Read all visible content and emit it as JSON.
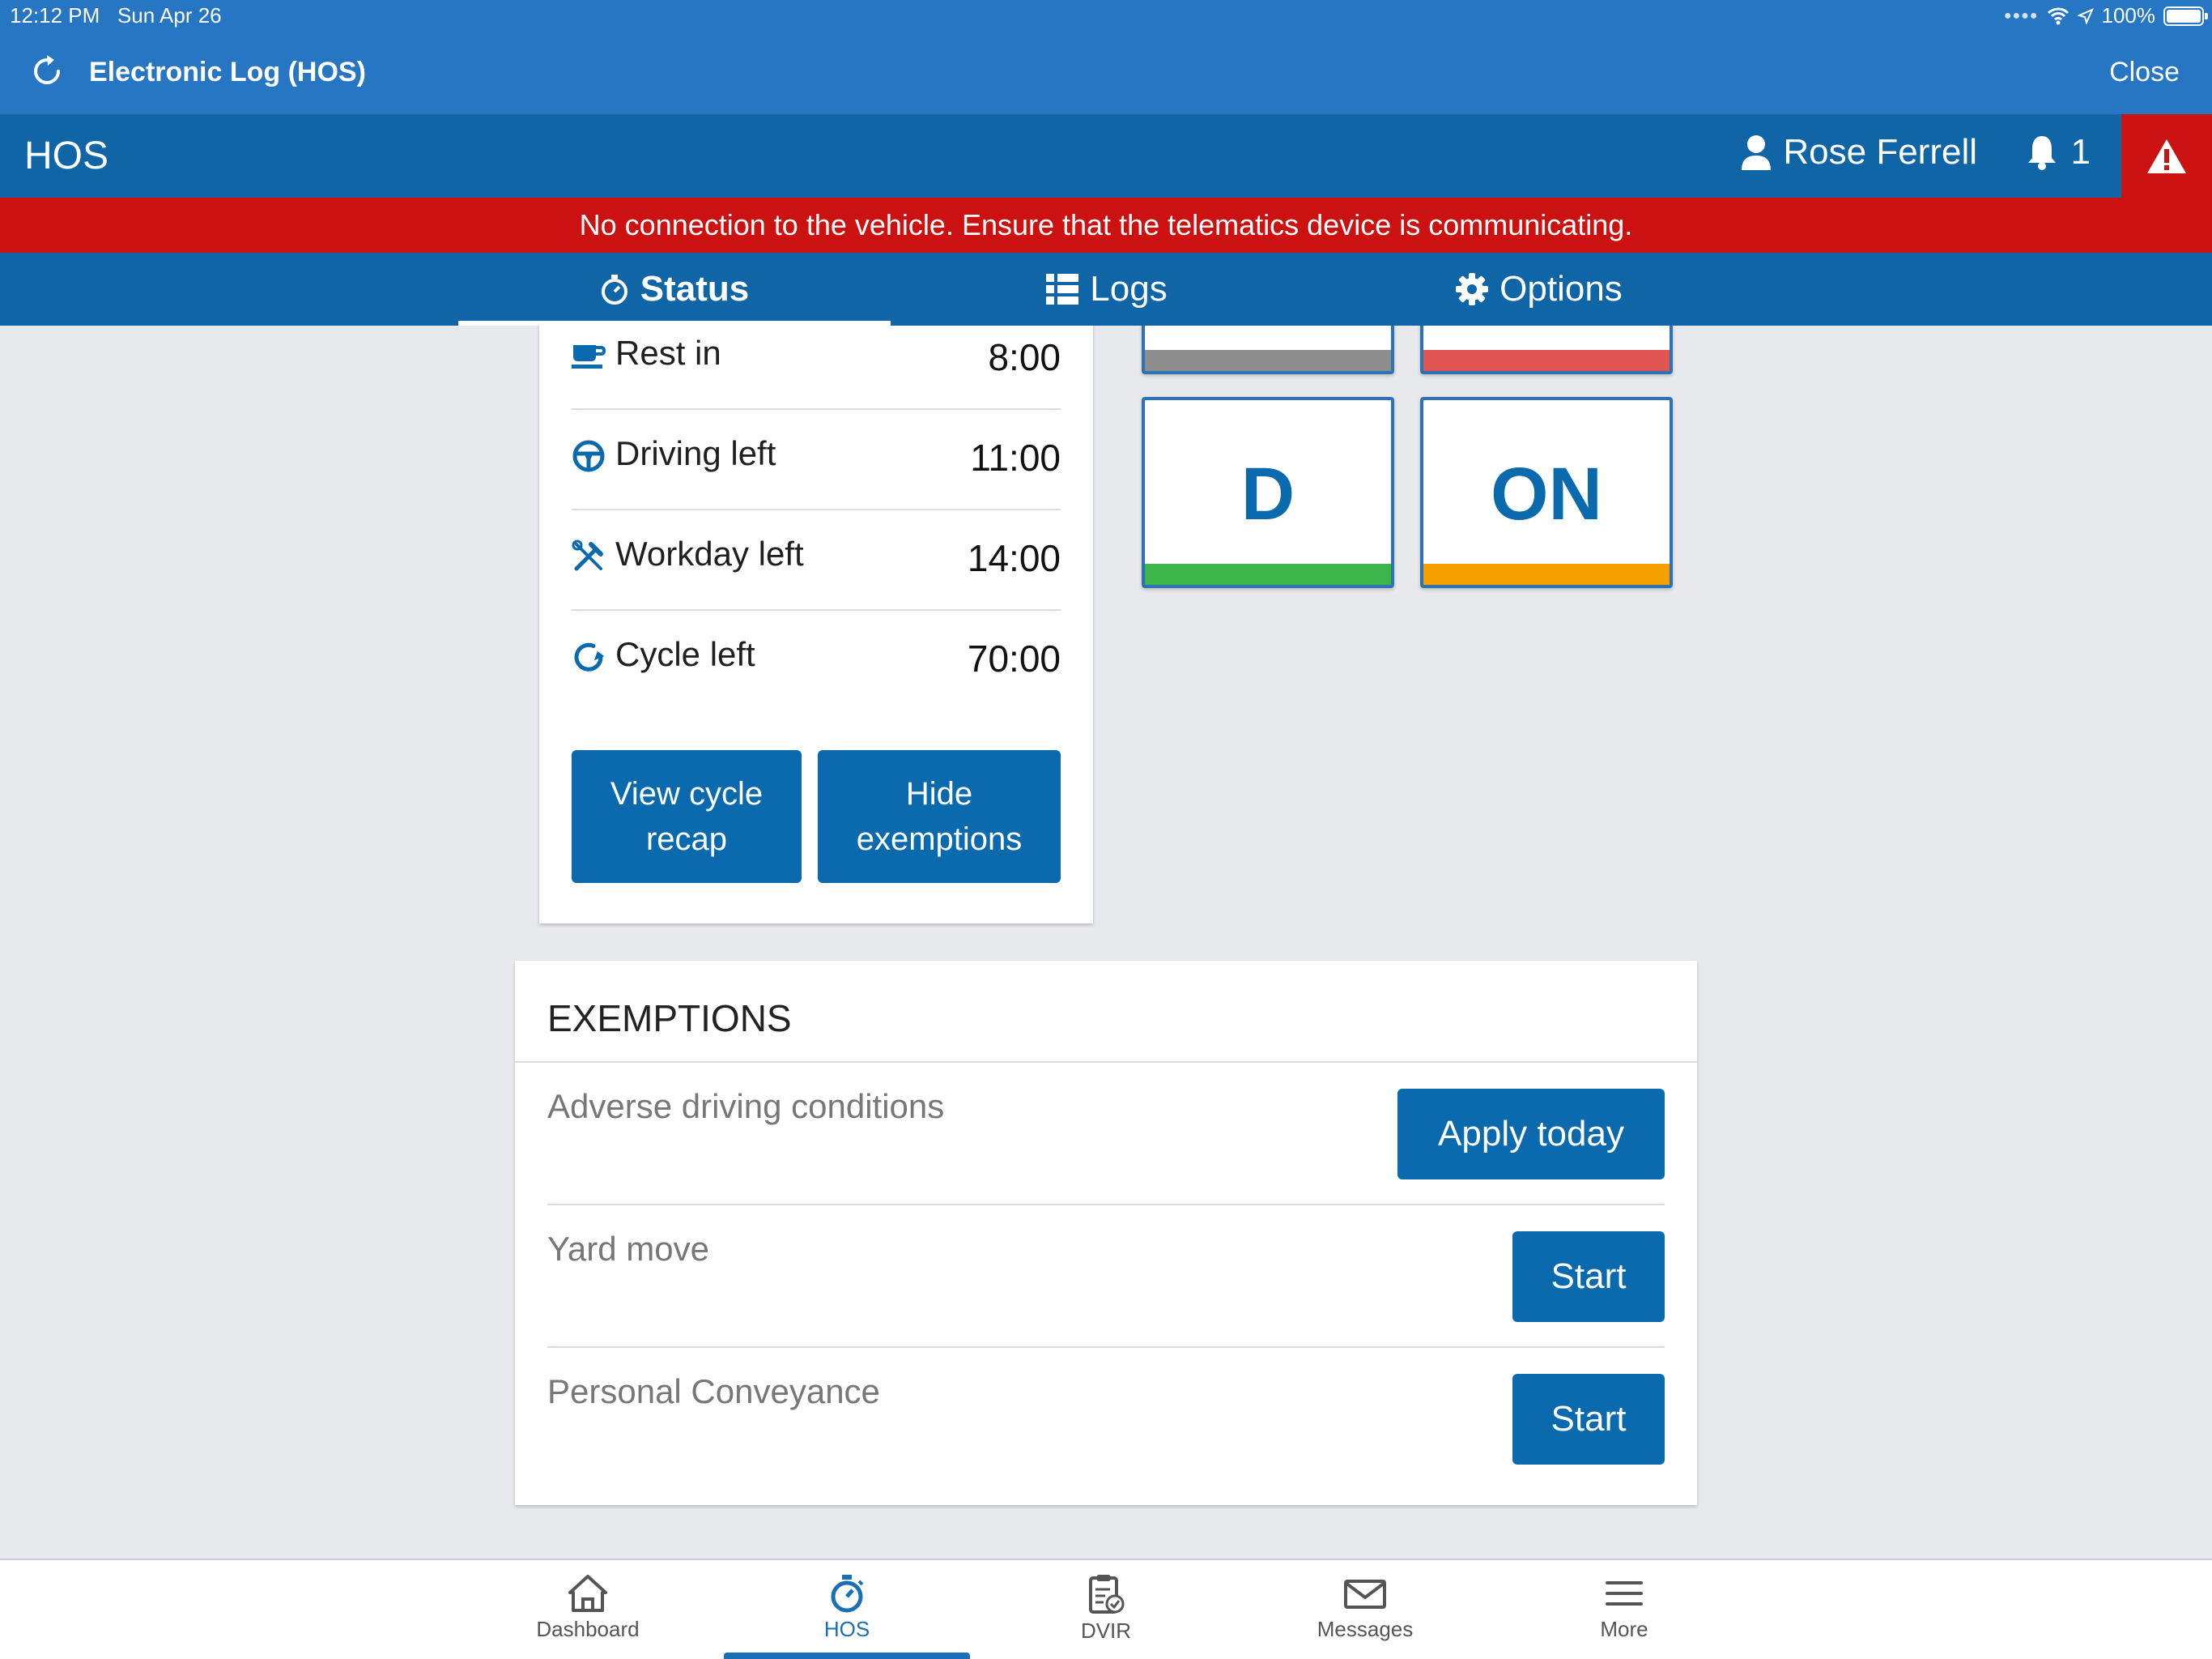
{
  "status_bar": {
    "time": "12:12 PM",
    "date": "Sun Apr 26",
    "battery": "100%"
  },
  "app_header": {
    "title": "Electronic Log (HOS)",
    "close_label": "Close"
  },
  "hos_bar": {
    "title": "HOS",
    "user_name": "Rose Ferrell",
    "notification_count": "1"
  },
  "banner": {
    "message": "No connection to the vehicle. Ensure that the telematics device is communicating."
  },
  "tabs": [
    {
      "label": "Status",
      "active": true
    },
    {
      "label": "Logs",
      "active": false
    },
    {
      "label": "Options",
      "active": false
    }
  ],
  "summary": {
    "rows": [
      {
        "label": "Rest in",
        "value": "8:00",
        "icon": "coffee-cup-icon"
      },
      {
        "label": "Driving left",
        "value": "11:00",
        "icon": "steering-wheel-icon"
      },
      {
        "label": "Workday left",
        "value": "14:00",
        "icon": "tools-icon"
      },
      {
        "label": "Cycle left",
        "value": "70:00",
        "icon": "cycle-icon"
      }
    ],
    "view_cycle_recap": "View cycle recap",
    "hide_exemptions": "Hide exemptions"
  },
  "duty_tiles": {
    "top_left_color": "#8e8e8e",
    "top_right_color": "#e05454",
    "d": {
      "label": "D",
      "color": "#3bb54a"
    },
    "on": {
      "label": "ON",
      "color": "#f5a000"
    }
  },
  "exemptions": {
    "title": "EXEMPTIONS",
    "items": [
      {
        "label": "Adverse driving conditions",
        "button": "Apply today"
      },
      {
        "label": "Yard move",
        "button": "Start"
      },
      {
        "label": "Personal Conveyance",
        "button": "Start"
      }
    ]
  },
  "bottom_nav": [
    {
      "label": "Dashboard",
      "icon": "home-icon"
    },
    {
      "label": "HOS",
      "icon": "stopwatch-icon",
      "active": true
    },
    {
      "label": "DVIR",
      "icon": "clipboard-icon"
    },
    {
      "label": "Messages",
      "icon": "envelope-icon"
    },
    {
      "label": "More",
      "icon": "menu-icon"
    }
  ],
  "colors": {
    "header_blue": "#2676c4",
    "bar_blue": "#0f65a6",
    "alert_red": "#cc1111",
    "button_blue": "#0b6aad"
  }
}
